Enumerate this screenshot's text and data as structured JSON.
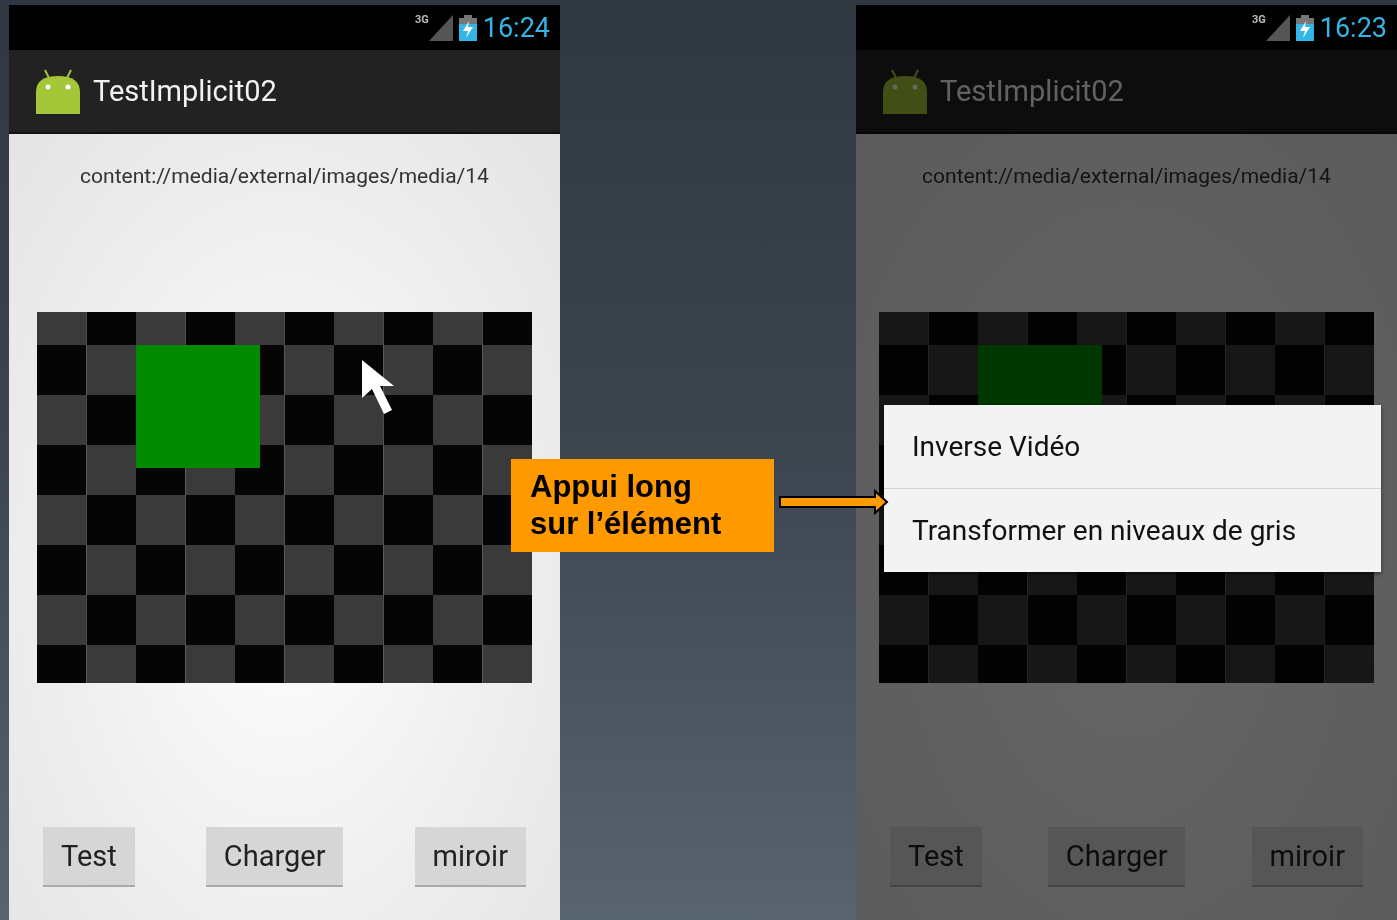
{
  "screens": [
    {
      "status_bar": {
        "network": "3G",
        "time": "16:24"
      },
      "app_title": "TestImplicit02",
      "uri": "content://media/external/images/media/14",
      "dimmed": false,
      "cursor": true,
      "buttons": [
        "Test",
        "Charger",
        "miroir"
      ]
    },
    {
      "status_bar": {
        "network": "3G",
        "time": "16:23"
      },
      "app_title": "TestImplicit02",
      "uri": "content://media/external/images/media/14",
      "dimmed": true,
      "cursor": false,
      "buttons": [
        "Test",
        "Charger",
        "miroir"
      ],
      "context_menu": [
        "Inverse Vidéo",
        "Transformer en niveaux de gris"
      ]
    }
  ],
  "annotation": {
    "text": "Appui long\nsur l’élément"
  }
}
